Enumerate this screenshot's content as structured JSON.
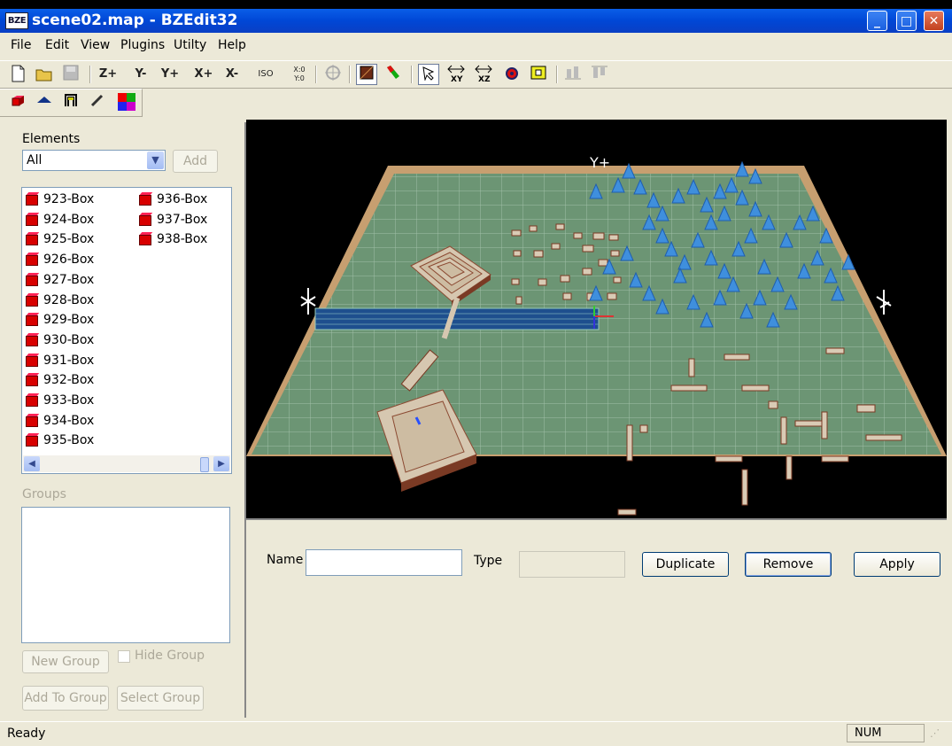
{
  "window": {
    "title": "scene02.map - BZEdit32",
    "app_icon_text": "BZE",
    "minimize": "_",
    "maximize": "□",
    "close": "✕"
  },
  "menu": [
    "File",
    "Edit",
    "View",
    "Plugins",
    "Utilty",
    "Help"
  ],
  "toolbar1": {
    "z_plus": "Z+",
    "y_minus": "Y-",
    "y_plus": "Y+",
    "x_plus": "X+",
    "x_minus": "X-",
    "iso": "ISO",
    "xy0": "X:0 Y:0"
  },
  "elements_panel": {
    "label": "Elements",
    "filter_value": "All",
    "add_label": "Add",
    "items_col1": [
      "923-Box",
      "924-Box",
      "925-Box",
      "926-Box",
      "927-Box",
      "928-Box",
      "929-Box",
      "930-Box",
      "931-Box",
      "932-Box",
      "933-Box",
      "934-Box",
      "935-Box"
    ],
    "items_col2": [
      "936-Box",
      "937-Box",
      "938-Box"
    ]
  },
  "groups_panel": {
    "label": "Groups",
    "new_group": "New Group",
    "hide_group": "Hide Group",
    "add_to_group": "Add To Group",
    "select_group": "Select Group"
  },
  "viewport": {
    "axis_y_top": "Y+",
    "ground_color": "#6c9574",
    "wall_color": "#c79f70"
  },
  "properties": {
    "name_label": "Name",
    "name_value": "",
    "type_label": "Type",
    "type_value": "",
    "duplicate": "Duplicate",
    "remove": "Remove",
    "apply": "Apply"
  },
  "status": {
    "text": "Ready",
    "num": "NUM"
  }
}
